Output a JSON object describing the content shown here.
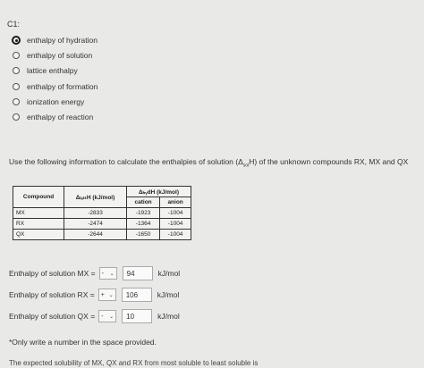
{
  "question": {
    "number": "C1:",
    "options": [
      {
        "label": "enthalpy of hydration",
        "selected": true
      },
      {
        "label": "enthalpy of solution",
        "selected": false
      },
      {
        "label": "lattice enthalpy",
        "selected": false
      },
      {
        "label": "enthalpy of formation",
        "selected": false
      },
      {
        "label": "ionization energy",
        "selected": false
      },
      {
        "label": "enthalpy of reaction",
        "selected": false
      }
    ]
  },
  "prompt": {
    "text_before": "Use the following information to calculate the enthalpies of solution (Δ",
    "subscript": "sol",
    "text_after": "H) of the unknown compounds RX, MX and QX"
  },
  "table": {
    "header_compound": "Compound",
    "header_lattice": "ΔₗₐₜₜH (kJ/mol)",
    "header_hydration": "ΔₕᵧdH (kJ/mol)",
    "header_cation": "cation",
    "header_anion": "anion",
    "rows": [
      {
        "compound": "MX",
        "lattice": "-2833",
        "cation": "-1923",
        "anion": "-1004"
      },
      {
        "compound": "RX",
        "lattice": "-2474",
        "cation": "-1364",
        "anion": "-1004"
      },
      {
        "compound": "QX",
        "lattice": "-2644",
        "cation": "-1650",
        "anion": "-1004"
      }
    ]
  },
  "answers": [
    {
      "label": "Enthalpy of solution MX =",
      "sign": "-",
      "value": "94",
      "unit": "kJ/mol"
    },
    {
      "label": "Enthalpy of solution RX =",
      "sign": "+",
      "value": "106",
      "unit": "kJ/mol"
    },
    {
      "label": "Enthalpy of solution QX =",
      "sign": "-",
      "value": "10",
      "unit": "kJ/mol"
    }
  ],
  "note": "*Only write a number in the space provided.",
  "cutoff": "The expected solubility of MX, QX and RX from most soluble to least soluble is"
}
